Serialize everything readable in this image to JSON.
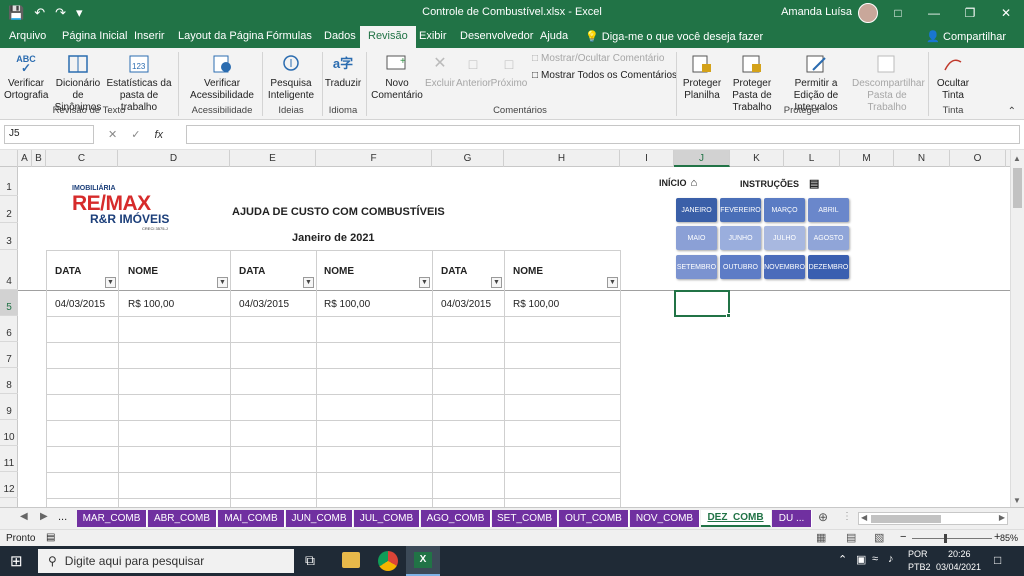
{
  "window": {
    "title": "Controle de Combustível.xlsx  -  Excel",
    "user": "Amanda Luísa"
  },
  "ribbon_tabs": [
    "Arquivo",
    "Página Inicial",
    "Inserir",
    "Layout da Página",
    "Fórmulas",
    "Dados",
    "Revisão",
    "Exibir",
    "Desenvolvedor",
    "Ajuda"
  ],
  "active_tab": "Revisão",
  "tell_me": "Diga-me o que você deseja fazer",
  "share": "Compartilhar",
  "ribbon": {
    "spelling": "Verificar Ortografia",
    "thesaurus": "Dicionário de Sinônimos",
    "workbook_stats": "Estatísticas da pasta de trabalho",
    "group_proofing": "Revisão de Texto",
    "accessibility": "Verificar Acessibilidade",
    "group_accessibility": "Acessibilidade",
    "smart_lookup": "Pesquisa Inteligente",
    "group_insights": "Ideias",
    "translate": "Traduzir",
    "group_language": "Idioma",
    "new_comment": "Novo Comentário",
    "delete": "Excluir",
    "previous": "Anterior",
    "next": "Próximo",
    "show_hide_comment": "Mostrar/Ocultar Comentário",
    "show_all_comments": "Mostrar Todos os Comentários",
    "group_comments": "Comentários",
    "protect_sheet": "Proteger Planilha",
    "protect_workbook": "Proteger Pasta de Trabalho",
    "allow_edit_ranges": "Permitir a Edição de Intervalos",
    "unshare_workbook": "Descompartilhar Pasta de Trabalho",
    "group_protect": "Proteger",
    "hide_ink": "Ocultar Tinta",
    "group_ink": "Tinta"
  },
  "formula_bar": {
    "name_box": "J5",
    "fx": "fx",
    "value": ""
  },
  "columns": [
    "A",
    "B",
    "C",
    "D",
    "E",
    "F",
    "G",
    "H",
    "I",
    "J",
    "K",
    "L",
    "M",
    "N",
    "O"
  ],
  "rows": [
    "1",
    "2",
    "3",
    "4",
    "5",
    "6",
    "7",
    "8",
    "9",
    "10",
    "11",
    "12"
  ],
  "sheet": {
    "logo_top": "IMOBILIÁRIA",
    "logo_main": "RE/MAX",
    "logo_sub": "R&R IMÓVEIS",
    "logo_creci": "CRECI 3575-J",
    "title": "AJUDA DE CUSTO COM COMBUSTÍVEIS",
    "month_title": "Janeiro de 2021",
    "inicio": "INÍCIO",
    "instrucoes": "INSTRUÇÕES",
    "headers": [
      "DATA",
      "NOME",
      "DATA",
      "NOME",
      "DATA",
      "NOME"
    ],
    "row5": [
      "04/03/2015",
      "R$ 100,00",
      "04/03/2015",
      "R$ 100,00",
      "04/03/2015",
      "R$ 100,00"
    ],
    "months": [
      "JANEIRO",
      "FEVEREIRO",
      "MARÇO",
      "ABRIL",
      "MAIO",
      "JUNHO",
      "JULHO",
      "AGOSTO",
      "SETEMBRO",
      "OUTUBRO",
      "NOVEMBRO",
      "DEZEMBRO"
    ],
    "month_colors": [
      "#3a5fa8",
      "#4a6fb8",
      "#5b7cc4",
      "#6a87cb",
      "#8ba0d6",
      "#9aaedd",
      "#a8b8e0",
      "#90a5d8",
      "#7b93d0",
      "#5d7cc6",
      "#4b6cbb",
      "#3a5fb0"
    ]
  },
  "sheet_tabs": [
    "...",
    "MAR_COMB",
    "ABR_COMB",
    "MAI_COMB",
    "JUN_COMB",
    "JUL_COMB",
    "AGO_COMB",
    "SET_COMB",
    "OUT_COMB",
    "NOV_COMB",
    "DEZ_COMB",
    "DU ..."
  ],
  "active_sheet": "DEZ_COMB",
  "status": {
    "ready": "Pronto",
    "zoom": "85%"
  },
  "taskbar": {
    "search_placeholder": "Digite aqui para pesquisar",
    "lang": "POR",
    "layout": "PTB2",
    "time": "20:26",
    "date": "03/04/2021"
  }
}
